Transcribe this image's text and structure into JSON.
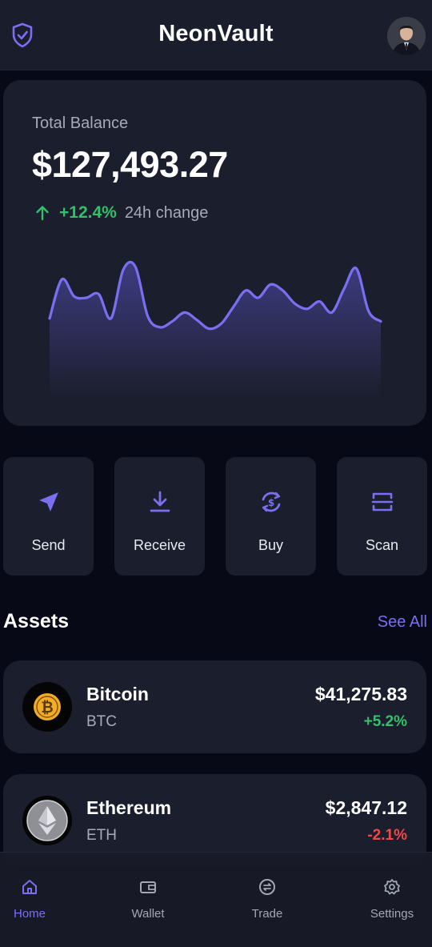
{
  "header": {
    "title": "NeonVault",
    "logo_icon": "shield-check-icon",
    "avatar": "user-avatar"
  },
  "balance": {
    "label": "Total Balance",
    "value": "$127,493.27",
    "change_icon": "arrow-up-icon",
    "change_pct": "+12.4%",
    "change_label": "24h change",
    "sparkline": [
      0.22,
      0.75,
      0.52,
      0.5,
      0.55,
      0.22,
      0.88,
      0.92,
      0.25,
      0.1,
      0.18,
      0.3,
      0.2,
      0.08,
      0.15,
      0.38,
      0.6,
      0.5,
      0.68,
      0.6,
      0.42,
      0.35,
      0.45,
      0.3,
      0.62,
      0.9,
      0.32,
      0.18
    ]
  },
  "actions": [
    {
      "label": "Send",
      "icon": "send-icon"
    },
    {
      "label": "Receive",
      "icon": "download-icon"
    },
    {
      "label": "Buy",
      "icon": "buy-cycle-icon"
    },
    {
      "label": "Scan",
      "icon": "scan-icon"
    }
  ],
  "assets": {
    "title": "Assets",
    "see_all": "See All",
    "items": [
      {
        "name": "Bitcoin",
        "symbol": "BTC",
        "price": "$41,275.83",
        "change": "+5.2%",
        "trend": "up",
        "icon": "bitcoin-icon"
      },
      {
        "name": "Ethereum",
        "symbol": "ETH",
        "price": "$2,847.12",
        "change": "-2.1%",
        "trend": "down",
        "icon": "ethereum-icon"
      }
    ]
  },
  "nav": {
    "items": [
      {
        "label": "Home",
        "icon": "home-icon",
        "active": true
      },
      {
        "label": "Wallet",
        "icon": "wallet-icon",
        "active": false
      },
      {
        "label": "Trade",
        "icon": "trade-icon",
        "active": false
      },
      {
        "label": "Settings",
        "icon": "gear-icon",
        "active": false
      }
    ]
  },
  "colors": {
    "accent": "#7b6ff1",
    "positive": "#32c16a",
    "negative": "#ef4a4a",
    "card": "#1b1e2c",
    "background": "#070a16"
  }
}
